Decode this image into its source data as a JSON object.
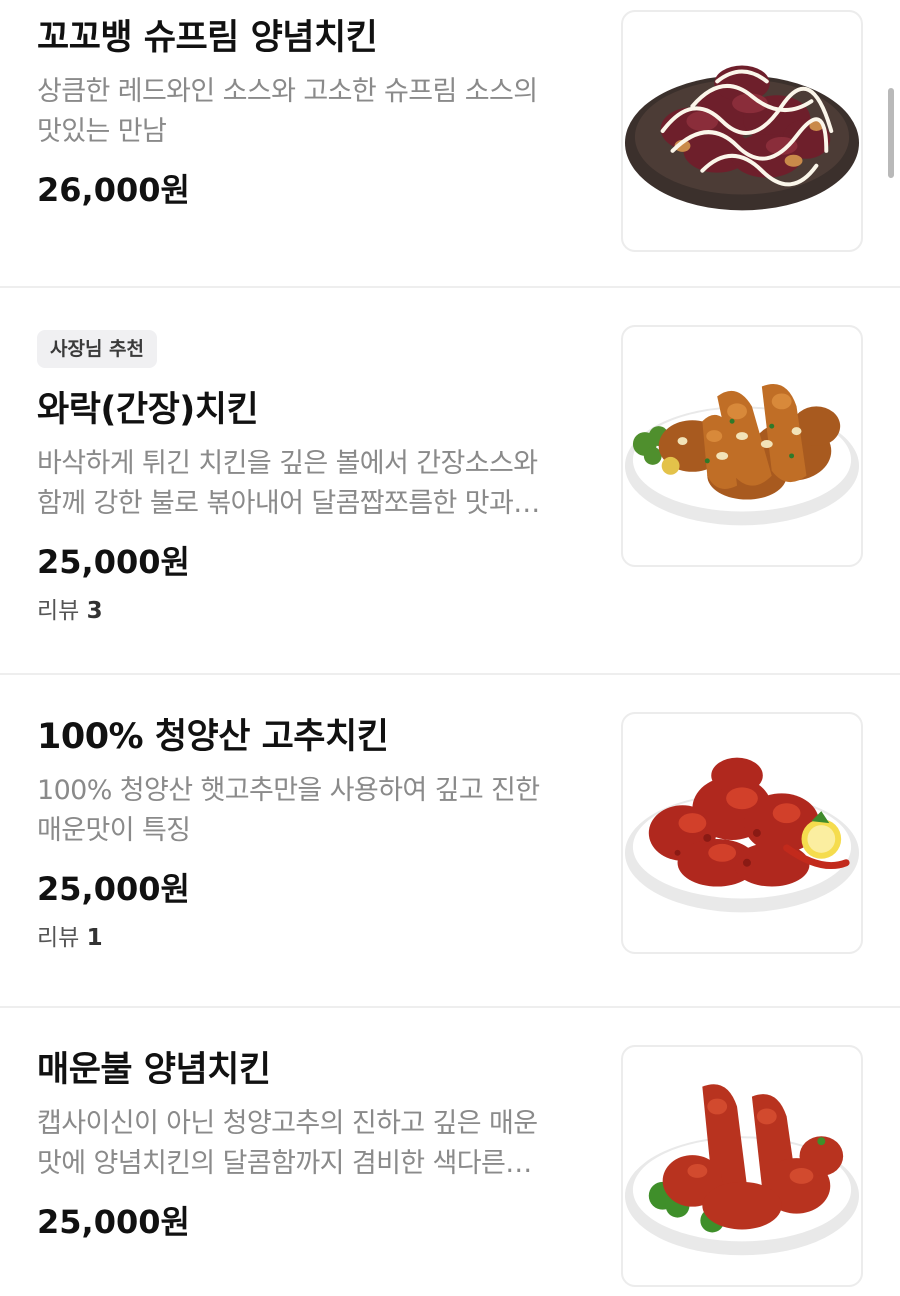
{
  "menu": {
    "items": [
      {
        "name": "꼬꼬뱅 슈프림 양념치킨",
        "desc_line1": "상큼한 레드와인 소스와 고소한 슈프림 소스의",
        "desc_line2": "맛있는 만남",
        "price": "26,000원"
      },
      {
        "badge": "사장님 추천",
        "name": "와락(간장)치킨",
        "desc_line1": "바삭하게 튀긴 치킨을 깊은 볼에서 간장소스와",
        "desc_line2": "함께 강한 불로 볶아내어 달콤짭쪼름한 맛과…",
        "price": "25,000원",
        "review_label": "리뷰",
        "review_count": "3"
      },
      {
        "name": "100% 청양산 고추치킨",
        "desc_line1": "100% 청양산 햇고추만을 사용하여 깊고 진한",
        "desc_line2": "매운맛이 특징",
        "price": "25,000원",
        "review_label": "리뷰",
        "review_count": "1"
      },
      {
        "name": "매운불 양념치킨",
        "desc_line1": "캡사이신이 아닌 청양고추의 진하고 깊은 매운",
        "desc_line2": "맛에 양념치킨의 달콤함까지 겸비한 색다른…",
        "price": "25,000원"
      }
    ]
  },
  "images": [
    "red-wine-supreme-sauce-chicken-photo",
    "soy-garlic-chicken-photo",
    "cheongyang-pepper-chicken-photo",
    "spicy-fire-yangnyeom-chicken-photo"
  ],
  "colors": {
    "text_primary": "#111111",
    "text_secondary": "#8a8a8a",
    "badge_bg": "#f0f0f2",
    "divider": "#eeeeee"
  }
}
